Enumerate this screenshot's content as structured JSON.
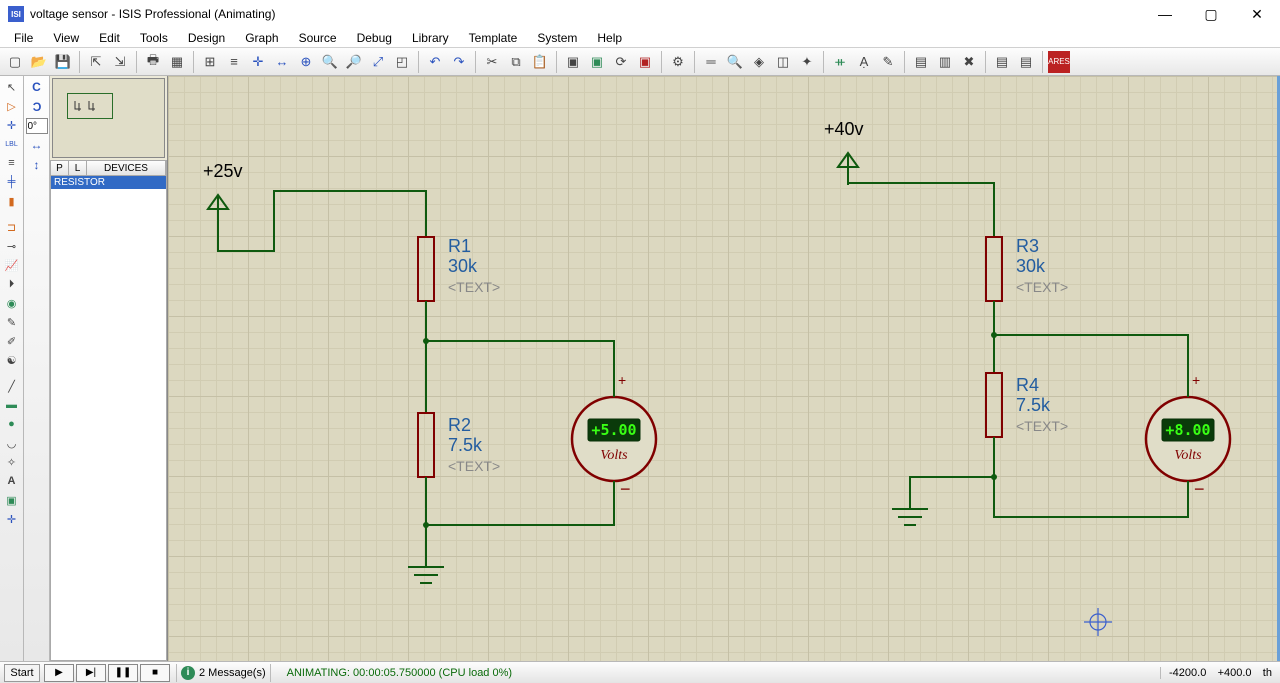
{
  "window": {
    "app_icon": "ISIS",
    "title": "voltage sensor - ISIS Professional (Animating)"
  },
  "menu": [
    "File",
    "View",
    "Edit",
    "Tools",
    "Design",
    "Graph",
    "Source",
    "Debug",
    "Library",
    "Template",
    "System",
    "Help"
  ],
  "sidepanel": {
    "headers": {
      "p": "P",
      "l": "L",
      "devices": "DEVICES"
    },
    "items": [
      "RESISTOR"
    ]
  },
  "rotation_input": "0°",
  "schematic": {
    "source1": {
      "label": "+25v"
    },
    "source2": {
      "label": "+40v"
    },
    "r1": {
      "name": "R1",
      "value": "30k",
      "text": "<TEXT>"
    },
    "r2": {
      "name": "R2",
      "value": "7.5k",
      "text": "<TEXT>"
    },
    "r3": {
      "name": "R3",
      "value": "30k",
      "text": "<TEXT>"
    },
    "r4": {
      "name": "R4",
      "value": "7.5k",
      "text": "<TEXT>"
    },
    "meter1": {
      "reading": "+5.00",
      "unit": "Volts"
    },
    "meter2": {
      "reading": "+8.00",
      "unit": "Volts"
    }
  },
  "status": {
    "start": "Start",
    "messages": "2 Message(s)",
    "anim": "ANIMATING: 00:00:05.750000 (CPU load 0%)",
    "coord_x": "-4200.0",
    "coord_y": "+400.0",
    "coord_unit": "th"
  }
}
